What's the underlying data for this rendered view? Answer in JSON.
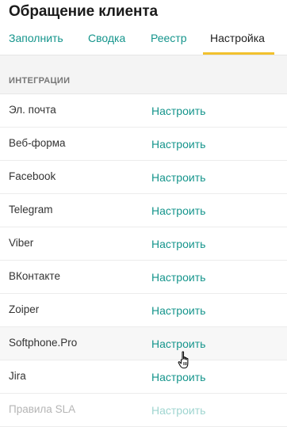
{
  "header": {
    "title": "Обращение клиента"
  },
  "tabs": [
    {
      "label": "Заполнить"
    },
    {
      "label": "Сводка"
    },
    {
      "label": "Реестр"
    },
    {
      "label": "Настройка"
    }
  ],
  "section": {
    "label": "ИНТЕГРАЦИИ"
  },
  "integrations": [
    {
      "name": "Эл. почта",
      "action": "Настроить"
    },
    {
      "name": "Веб-форма",
      "action": "Настроить"
    },
    {
      "name": "Facebook",
      "action": "Настроить"
    },
    {
      "name": "Telegram",
      "action": "Настроить"
    },
    {
      "name": "Viber",
      "action": "Настроить"
    },
    {
      "name": "ВКонтакте",
      "action": "Настроить"
    },
    {
      "name": "Zoiper",
      "action": "Настроить"
    },
    {
      "name": "Softphone.Pro",
      "action": "Настроить"
    },
    {
      "name": "Jira",
      "action": "Настроить"
    },
    {
      "name": "Правила SLA",
      "action": "Настроить"
    }
  ],
  "colors": {
    "accent": "#15958c",
    "active_tab_underline": "#f2c12e"
  },
  "icons": {
    "pointer": "hand-cursor-icon"
  }
}
